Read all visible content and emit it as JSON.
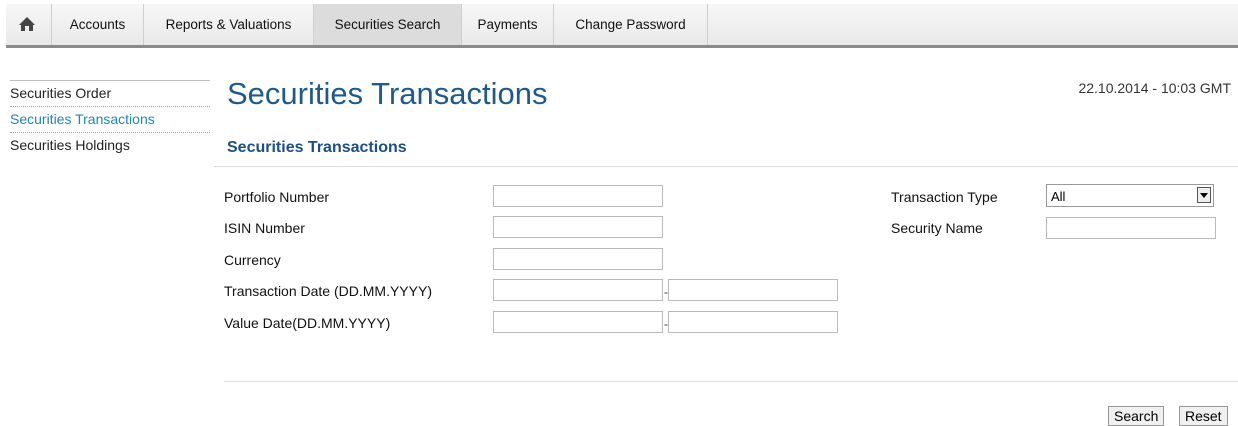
{
  "nav": {
    "home_icon": "home-icon",
    "items": [
      "Accounts",
      "Reports & Valuations",
      "Securities Search",
      "Payments",
      "Change Password"
    ],
    "active": "Securities Search"
  },
  "sidebar": {
    "items": [
      "Securities Order",
      "Securities Transactions",
      "Securities Holdings"
    ],
    "active": "Securities Transactions"
  },
  "page": {
    "title": "Securities Transactions",
    "datetime": "22.10.2014 - 10:03  GMT",
    "subtitle": "Securities Transactions"
  },
  "form": {
    "portfolio_number": {
      "label": "Portfolio Number",
      "value": ""
    },
    "isin_number": {
      "label": "ISIN Number",
      "value": ""
    },
    "currency": {
      "label": "Currency",
      "value": ""
    },
    "transaction_date": {
      "label": "Transaction Date (DD.MM.YYYY)",
      "from": "",
      "to": "",
      "separator": "-"
    },
    "value_date": {
      "label": "Value Date(DD.MM.YYYY)",
      "from": "",
      "to": "",
      "separator": "-"
    },
    "transaction_type": {
      "label": "Transaction Type",
      "selected": "All"
    },
    "security_name": {
      "label": "Security Name",
      "value": ""
    }
  },
  "buttons": {
    "search": "Search",
    "reset": "Reset"
  },
  "colors": {
    "title": "#1f5a8f",
    "link_active": "#1f86b8",
    "subtitle": "#1a4f86"
  }
}
